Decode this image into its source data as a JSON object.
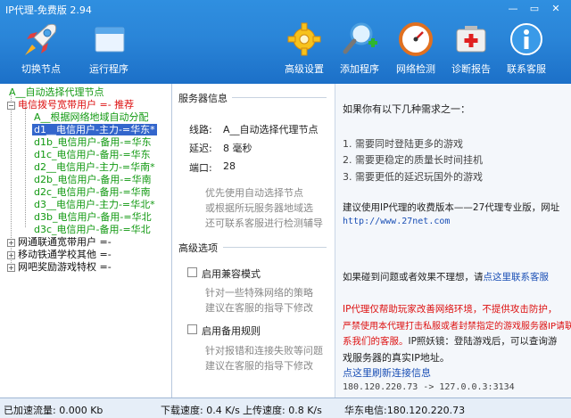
{
  "window": {
    "title": "IP代理-免费版 2.94",
    "min": "—",
    "restore": "▭",
    "close": "✕"
  },
  "toolbar": {
    "switch_node": "切换节点",
    "run_program": "运行程序",
    "advanced": "高级设置",
    "add_program": "添加程序",
    "net_check": "网络检测",
    "diagnose": "诊断报告",
    "contact": "联系客服"
  },
  "tree": {
    "auto": "A__自动选择代理节点",
    "telecom": "电信拨号宽带用户 =- 推荐",
    "items": [
      "A__根据网络地域自动分配",
      "d1__电信用户-主力-=华东*",
      "d1b_电信用户-备用-=华东",
      "d1c_电信用户-备用-=华东",
      "d2__电信用户-主力-=华南*",
      "d2b_电信用户-备用-=华南",
      "d2c_电信用户-备用-=华南",
      "d3__电信用户-主力-=华北*",
      "d3b_电信用户-备用-=华北",
      "d3c_电信用户-备用-=华北"
    ],
    "groups": [
      "网通联通宽带用户 =-",
      "移动铁通学校其他 =-",
      "网吧奖励游戏特权 =-"
    ]
  },
  "server": {
    "title": "服务器信息",
    "line_label": "线路:",
    "line_value": "A__自动选择代理节点",
    "latency_label": "延迟:",
    "latency_value": "8 毫秒",
    "port_label": "端口:",
    "port_value": "28",
    "note1": "优先使用自动选择节点",
    "note2": "或根据所玩服务器地域选",
    "note3": "还可联系客服进行检测辅导"
  },
  "options": {
    "title": "高级选项",
    "compat_label": "启用兼容模式",
    "compat_note1": "针对一些特殊网络的策略",
    "compat_note2": "建议在客服的指导下修改",
    "backup_label": "启用备用规则",
    "backup_note1": "针对报错和连接失败等问题",
    "backup_note2": "建议在客服的指导下修改"
  },
  "right": {
    "intro": "如果你有以下几种需求之一：",
    "need1": "1.  需要同时登陆更多的游戏",
    "need2": "2.  需要更稳定的质量长时间挂机",
    "need3": "3.  需要更低的延迟玩国外的游戏",
    "suggest1": "建议使用IP代理的收费版本——27代理专业版，网址",
    "url": "http://www.27net.com",
    "problem_prefix": "如果碰到问题或者效果不理想，请",
    "problem_link": "点这里联系客服",
    "warn1": "IP代理仅帮助玩家改善网络环境，不提供攻击防护，",
    "warn2": "严禁使用本代理打击私服或者封禁指定的游戏服务器IP请联",
    "warn3_red": "系我们的客服。",
    "warn3_rest": "IP照妖镜：登陆游戏后，可以查询游",
    "warn4": "戏服务器的真实IP地址。",
    "refresh_link": "点这里刷新连接信息",
    "conn": "180.120.220.73 -> 127.0.0.3:3134"
  },
  "status": {
    "accel": "已加速流量: 0.000 Kb",
    "down": "下载速度: 0.4 K/s",
    "up": "上传速度: 0.8 K/s",
    "isp": "华东电信:180.120.220.73"
  }
}
